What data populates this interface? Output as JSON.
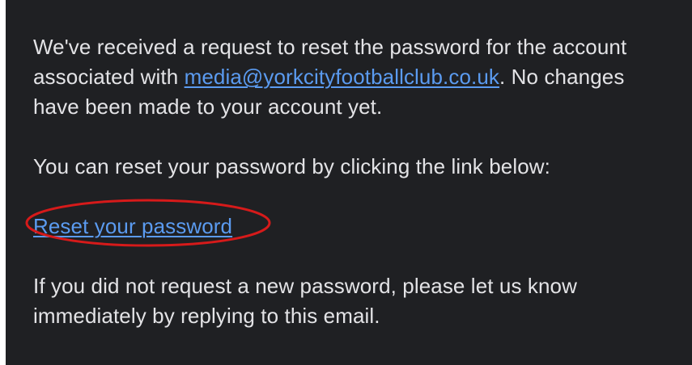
{
  "email": {
    "intro_text_1": "We've received a request to reset the password for the account associated with ",
    "email_address": "media@yorkcityfootballclub.co.uk",
    "intro_text_2": ". No changes have been made to your account yet.",
    "instruction_text": "You can reset your password by clicking the link below:",
    "reset_link_label": "Reset your password",
    "footer_text": "If you did not request a new password, please let us know immediately by replying to this email."
  },
  "colors": {
    "background": "#1f2023",
    "text": "#e3e3e6",
    "link": "#5b9bf0",
    "annotation": "#d61a1a"
  }
}
